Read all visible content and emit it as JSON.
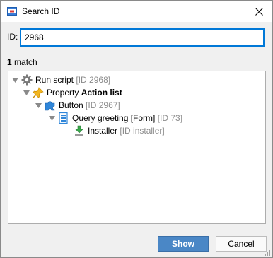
{
  "window": {
    "title": "Search ID",
    "icons": {
      "app": "search-id-app-icon",
      "close": "close-icon"
    }
  },
  "search": {
    "label": "ID:",
    "value": "2968"
  },
  "results": {
    "count": "1",
    "suffix": " match"
  },
  "tree": {
    "nodes": [
      {
        "icon": "gear-icon",
        "label": "Run script",
        "id": "[ID 2968]"
      },
      {
        "icon": "pin-icon",
        "label": "Property",
        "bold": "Action list"
      },
      {
        "icon": "puzzle-icon",
        "label": "Button",
        "id": "[ID 2967]"
      },
      {
        "icon": "form-icon",
        "label": "Query greeting [Form]",
        "id": "[ID 73]"
      },
      {
        "icon": "download-icon",
        "label": "Installer",
        "id": "[ID installer]"
      }
    ]
  },
  "buttons": {
    "show": "Show",
    "cancel": "Cancel"
  },
  "colors": {
    "accent": "#0078d7",
    "primary_button": "#4a87c6",
    "muted_text": "#8c8c8c"
  }
}
